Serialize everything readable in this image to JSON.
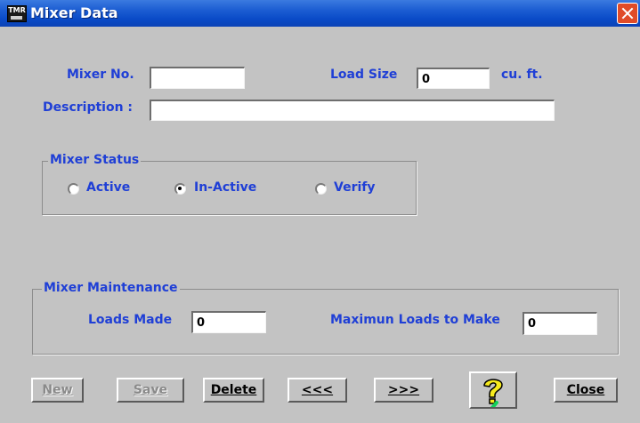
{
  "window": {
    "title": "Mixer Data",
    "icon_text": "TMR"
  },
  "form": {
    "mixer_no_label": "Mixer No.",
    "mixer_no_value": "",
    "load_size_label": "Load Size",
    "load_size_value": "0",
    "load_size_unit": "cu. ft.",
    "description_label": "Description :",
    "description_value": ""
  },
  "status": {
    "title": "Mixer Status",
    "options": [
      {
        "label": "Active",
        "selected": false
      },
      {
        "label": "In-Active",
        "selected": true
      },
      {
        "label": "Verify",
        "selected": false
      }
    ]
  },
  "maintenance": {
    "title": "Mixer Maintenance",
    "loads_made_label": "Loads Made",
    "loads_made_value": "0",
    "max_loads_label": "Maximun Loads to Make",
    "max_loads_value": "0"
  },
  "buttons": {
    "new": "New",
    "save": "Save",
    "delete": "Delete",
    "prev": "<<<",
    "next": ">>>",
    "close": "Close"
  },
  "icons": {
    "help": "help-question-icon",
    "close": "close-icon",
    "app": "tmr-app-icon"
  },
  "colors": {
    "label": "#1f3fd6",
    "titlebar": "#0a4bc8",
    "face": "#c3c3c3",
    "close": "#e04b28"
  }
}
